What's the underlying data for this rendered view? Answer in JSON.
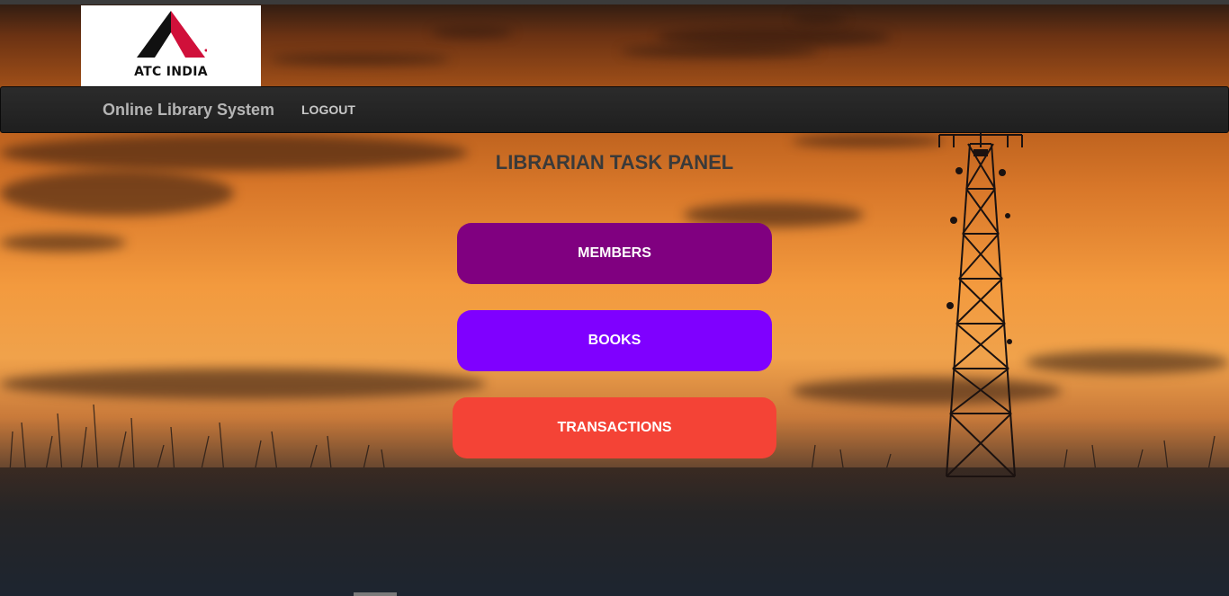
{
  "logo": {
    "text": "ATC INDIA",
    "colors": {
      "black": "#111111",
      "red": "#d0103a"
    }
  },
  "navbar": {
    "brand": "Online Library System",
    "links": [
      {
        "label": "LOGOUT"
      }
    ]
  },
  "main": {
    "title": "LIBRARIAN TASK PANEL",
    "buttons": [
      {
        "label": "MEMBERS",
        "color": "#800080"
      },
      {
        "label": "BOOKS",
        "color": "#7f00ff"
      },
      {
        "label": "TRANSACTIONS",
        "color": "#f44336"
      }
    ]
  }
}
